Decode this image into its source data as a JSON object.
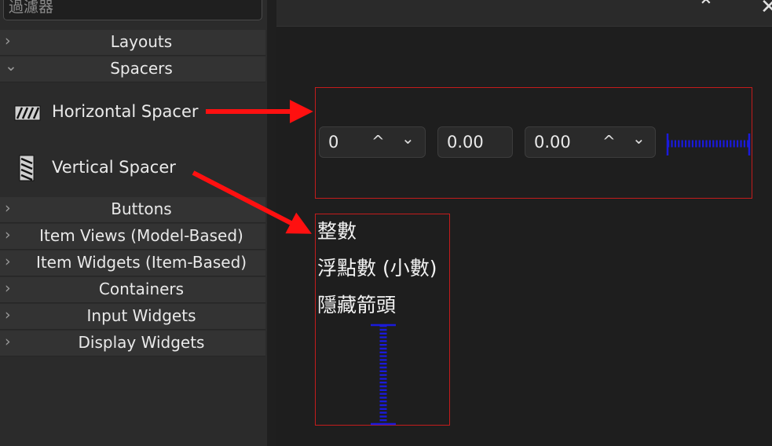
{
  "widgetbox": {
    "filter_placeholder": "過濾器",
    "categories_top": [
      {
        "label": "Layouts",
        "expanded": false
      },
      {
        "label": "Spacers",
        "expanded": true
      }
    ],
    "spacer_items": [
      {
        "label": "Horizontal Spacer",
        "icon": "horizontal-spacer-icon"
      },
      {
        "label": "Vertical Spacer",
        "icon": "vertical-spacer-icon"
      }
    ],
    "categories_bottom": [
      {
        "label": "Buttons",
        "expanded": false
      },
      {
        "label": "Item Views (Model-Based)",
        "expanded": false
      },
      {
        "label": "Item Widgets (Item-Based)",
        "expanded": false
      },
      {
        "label": "Containers",
        "expanded": false
      },
      {
        "label": "Input Widgets",
        "expanded": false
      },
      {
        "label": "Display Widgets",
        "expanded": false
      }
    ]
  },
  "canvas": {
    "spinboxes": [
      {
        "value": "0",
        "arrows": true
      },
      {
        "value": "0.00",
        "arrows": false
      },
      {
        "value": "0.00",
        "arrows": true
      }
    ],
    "labels": [
      "整數",
      "浮點數 (小數)",
      "隱藏箭頭"
    ]
  },
  "colors": {
    "layout_border": "#c41c1c",
    "spacer": "#1a1adc",
    "annotation_arrow": "#ff1010"
  }
}
